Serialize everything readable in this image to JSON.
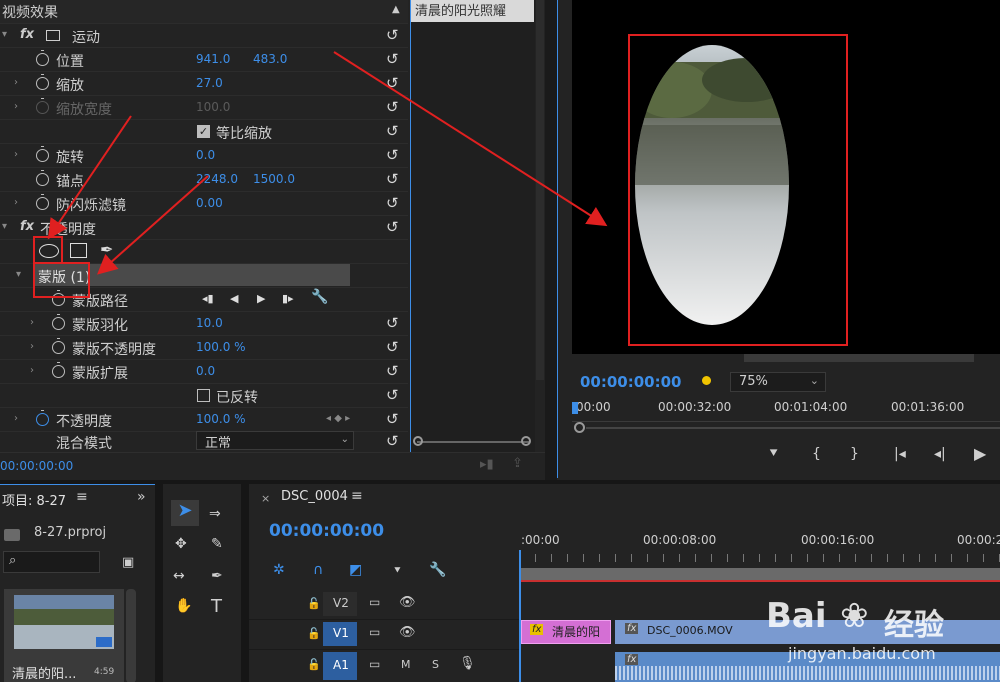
{
  "effects": {
    "title": "视频效果",
    "clip_tab": "清晨的阳光照耀",
    "motion": "运动",
    "position": {
      "label": "位置",
      "x": "941.0",
      "y": "483.0"
    },
    "scale": {
      "label": "缩放",
      "value": "27.0"
    },
    "scale_width": {
      "label": "缩放宽度",
      "value": "100.0"
    },
    "uniform_scale": "等比缩放",
    "rotation": {
      "label": "旋转",
      "value": "0.0"
    },
    "anchor": {
      "label": "锚点",
      "x": "2248.0",
      "y": "1500.0"
    },
    "antiflicker": {
      "label": "防闪烁滤镜",
      "value": "0.00"
    },
    "opacity_group": "不透明度",
    "mask": "蒙版 (1)",
    "mask_path": "蒙版路径",
    "mask_feather": {
      "label": "蒙版羽化",
      "value": "10.0"
    },
    "mask_opacity": {
      "label": "蒙版不透明度",
      "value": "100.0 %"
    },
    "mask_expand": {
      "label": "蒙版扩展",
      "value": "0.0"
    },
    "inverted": "已反转",
    "opacity": {
      "label": "不透明度",
      "value": "100.0 %"
    },
    "blend_mode": {
      "label": "混合模式",
      "value": "正常"
    },
    "timecode": "00:00:00:00",
    "fx": "fx"
  },
  "program": {
    "timecode": "00:00:00:00",
    "zoom": "75%",
    "ruler": [
      "00:00",
      "00:00:32:00",
      "00:01:04:00",
      "00:01:36:00"
    ]
  },
  "project": {
    "title": "项目: 8-27",
    "file": "8-27.prproj",
    "clip_name": "清晨的阳...",
    "clip_duration": "4:59"
  },
  "timeline": {
    "sequence": "DSC_0004",
    "timecode": "00:00:00:00",
    "ruler": [
      ":00:00",
      "00:00:08:00",
      "00:00:16:00",
      "00:00:2"
    ],
    "tracks": [
      {
        "name": "V2"
      },
      {
        "name": "V1"
      },
      {
        "name": "A1",
        "m": "M",
        "s": "S"
      }
    ],
    "clip_title": "清晨的阳",
    "clip_video": "DSC_0006.MOV"
  },
  "watermark": {
    "brand": "Bai",
    "brand2": "经验",
    "url": "jingyan.baidu.com"
  },
  "colors": {
    "accent": "#3d8ee8",
    "annotation": "#e02020",
    "title_clip": "#d46fd4"
  }
}
